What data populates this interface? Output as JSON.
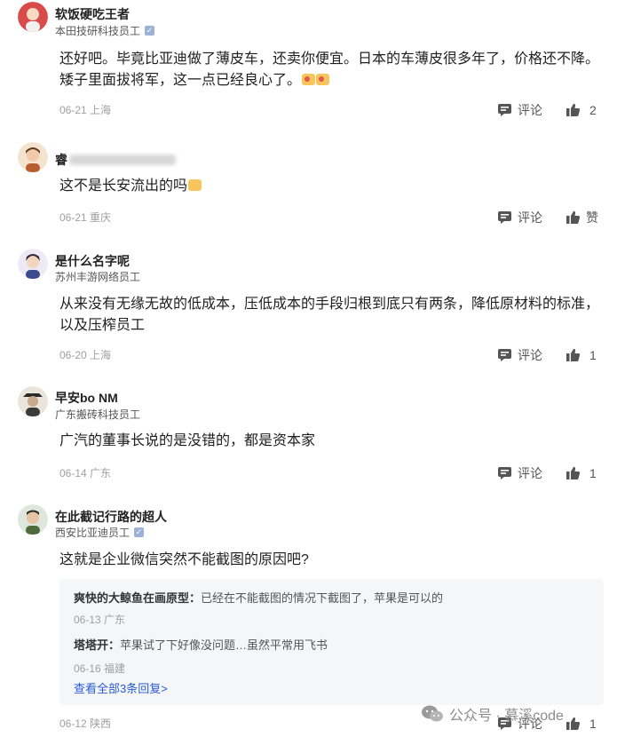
{
  "comments": [
    {
      "name": "软饭硬吃王者",
      "org": "本田技研科技员工",
      "verified": true,
      "text": "还好吧。毕竟比亚迪做了薄皮车，还卖你便宜。日本的车薄皮很多年了，价格还不降。矮子里面拔将军，这一点已经良心了。",
      "date": "06-21",
      "location": "上海",
      "reply_label": "评论",
      "like_count": "2"
    },
    {
      "name": "睿",
      "org": "",
      "verified": false,
      "text": "这不是长安流出的吗",
      "date": "06-21",
      "location": "重庆",
      "reply_label": "评论",
      "like_count": "赞"
    },
    {
      "name": "是什么名字呢",
      "org": "苏州丰游网络员工",
      "verified": false,
      "text": "从来没有无缘无故的低成本，压低成本的手段归根到底只有两条，降低原材料的标准，以及压榨员工",
      "date": "06-20",
      "location": "上海",
      "reply_label": "评论",
      "like_count": "1"
    },
    {
      "name": "早安bo NM",
      "org": "广东搬砖科技员工",
      "verified": false,
      "text": "广汽的董事长说的是没错的，都是资本家",
      "date": "06-14",
      "location": "广东",
      "reply_label": "评论",
      "like_count": "1"
    },
    {
      "name": "在此截记行路的超人",
      "org": "西安比亚迪员工",
      "verified": true,
      "text": "这就是企业微信突然不能截图的原因吧?",
      "date": "06-12",
      "location": "陕西",
      "reply_label": "评论",
      "like_count": "1",
      "replies": [
        {
          "author": "爽快的大鲸鱼在画原型",
          "text": "已经在不能截图的情况下截图了，苹果是可以的",
          "date": "06-13",
          "location": "广东"
        },
        {
          "author": "塔塔开",
          "text": "苹果试了下好像没问题…虽然平常用飞书",
          "date": "06-16",
          "location": "福建"
        }
      ],
      "view_all": "查看全部3条回复>"
    }
  ],
  "watermark": "公众号 · 慕溪code",
  "colors": {
    "accent_link": "#2a5bd7",
    "meta_gray": "#a0a0a0",
    "reply_bg": "#f5f6f8"
  }
}
